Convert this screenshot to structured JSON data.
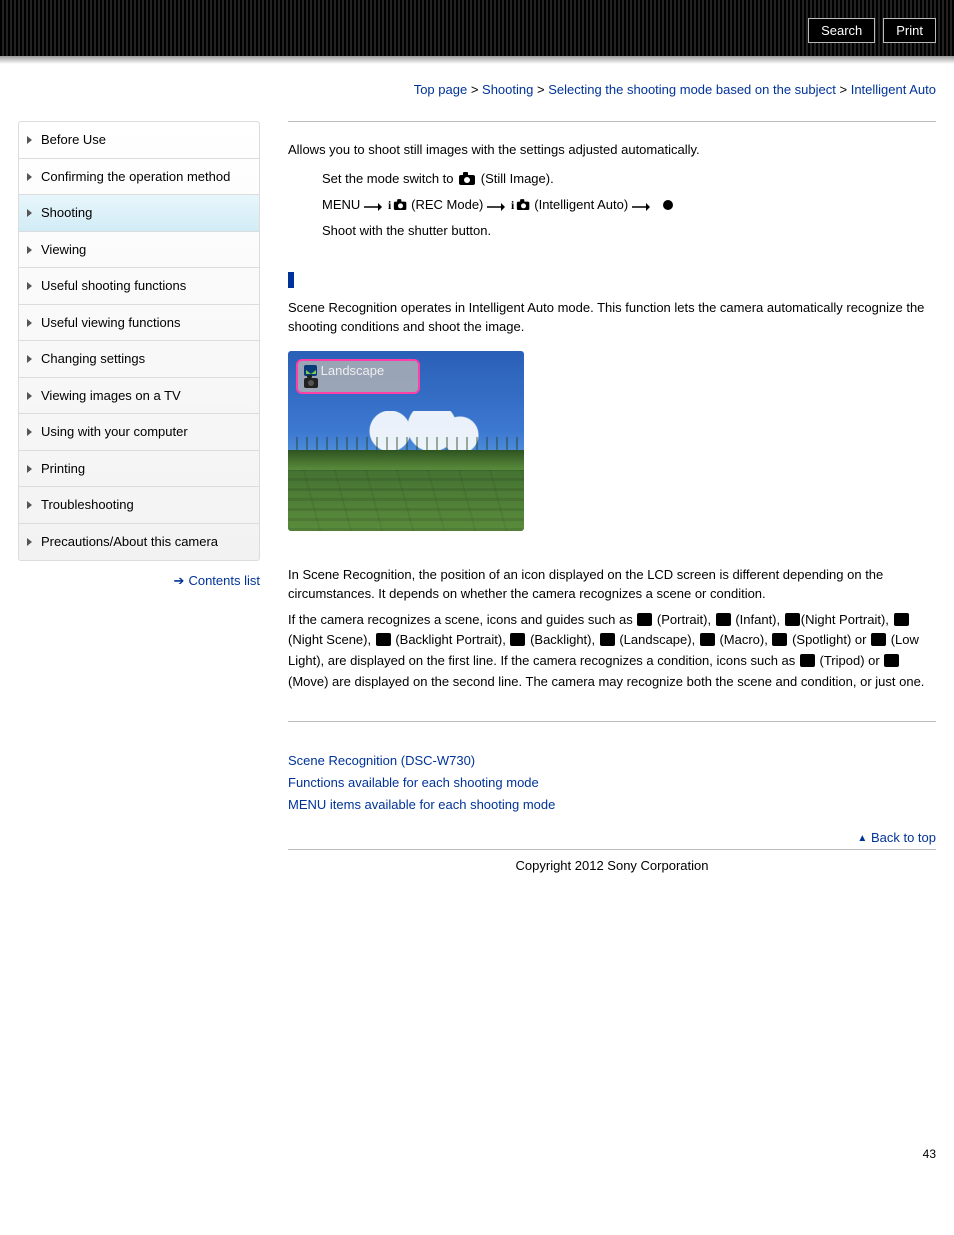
{
  "header": {
    "search_label": "Search",
    "print_label": "Print"
  },
  "breadcrumb": {
    "top": "Top page",
    "cat": "Shooting",
    "sub": "Selecting the shooting mode based on the subject",
    "current": "Intelligent Auto"
  },
  "sidebar": {
    "items": [
      "Before Use",
      "Confirming the operation method",
      "Shooting",
      "Viewing",
      "Useful shooting functions",
      "Useful viewing functions",
      "Changing settings",
      "Viewing images on a TV",
      "Using with your computer",
      "Printing",
      "Troubleshooting",
      "Precautions/About this camera"
    ],
    "active_index": 2,
    "contents_list": "Contents list"
  },
  "content": {
    "intro": "Allows you to shoot still images with the settings adjusted automatically.",
    "step1_a": "Set the mode switch to ",
    "step1_b": " (Still Image).",
    "step2_a": "MENU ",
    "step2_b": " (REC Mode) ",
    "step2_c": " (Intelligent Auto) ",
    "step3": "Shoot with the shutter button.",
    "scene_intro": "Scene Recognition operates in Intelligent Auto mode. This function lets the camera automatically recognize the shooting conditions and shoot the image.",
    "lcd_label": "Landscape",
    "scene_p1": "In Scene Recognition, the position of an icon displayed on the LCD screen is different depending on the circumstances. It depends on whether the camera recognizes a scene or condition.",
    "scene_p2_a": "If the camera recognizes a scene, icons and guides such as ",
    "scene_p2_portrait": " (Portrait), ",
    "scene_p2_infant": " (Infant), ",
    "scene_p2_nightportrait": "(Night Portrait), ",
    "scene_p2_nightscene": " (Night Scene), ",
    "scene_p2_backlightportrait": " (Backlight Portrait), ",
    "scene_p2_backlight": " (Backlight), ",
    "scene_p2_landscape": " (Landscape), ",
    "scene_p2_macro": " (Macro), ",
    "scene_p2_spotlight": " (Spotlight) or ",
    "scene_p2_lowlight": " (Low Light), are displayed on the first line. If the camera recognizes a condition, icons such as ",
    "scene_p2_tripod": " (Tripod) or ",
    "scene_p2_move": " (Move) are displayed on the second line. The camera may recognize both the scene and condition, or just one.",
    "links": [
      "Scene Recognition (DSC-W730)",
      "Functions available for each shooting mode",
      "MENU items available for each shooting mode"
    ],
    "back_to_top": "Back to top",
    "copyright": "Copyright 2012 Sony Corporation",
    "page_number": "43"
  }
}
